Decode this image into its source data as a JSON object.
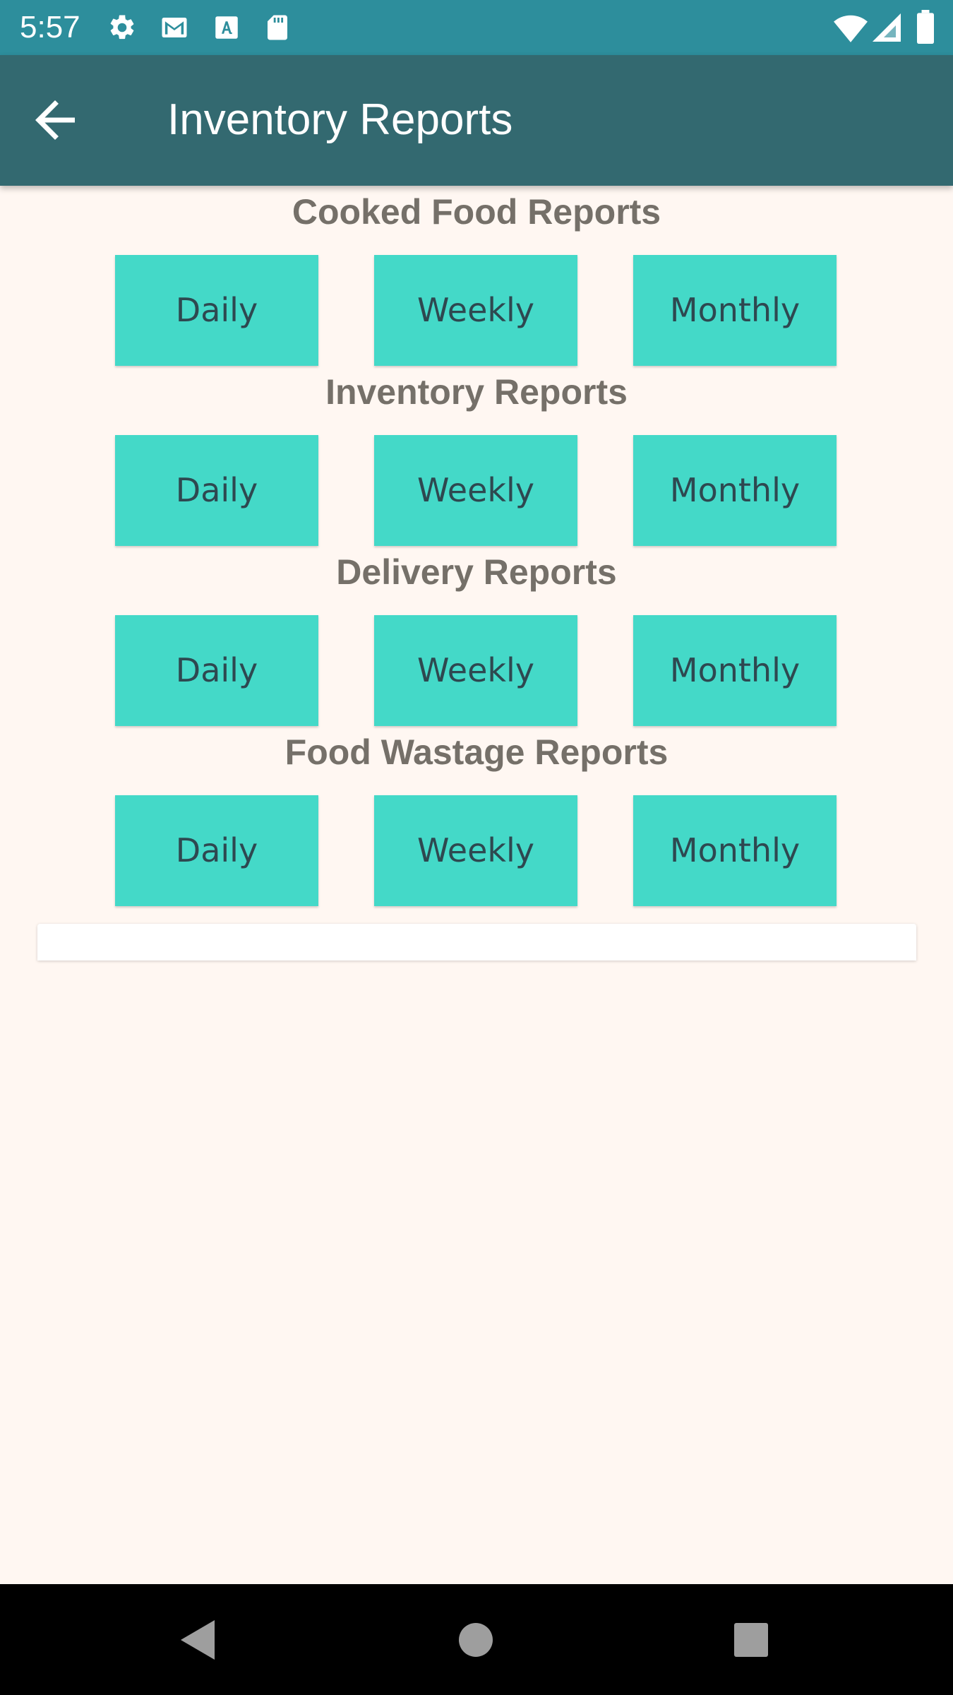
{
  "status_bar": {
    "time": "5:57",
    "left_icons": [
      "settings-icon",
      "gmail-icon",
      "a-notification-icon",
      "sd-card-icon"
    ],
    "right_icons": [
      "wifi-icon",
      "signal-icon",
      "battery-icon"
    ]
  },
  "app_bar": {
    "title": "Inventory Reports",
    "back_icon": "arrow-back-icon"
  },
  "sections": [
    {
      "title": "Cooked Food Reports",
      "buttons": [
        "Daily",
        "Weekly",
        "Monthly"
      ]
    },
    {
      "title": "Inventory Reports",
      "buttons": [
        "Daily",
        "Weekly",
        "Monthly"
      ]
    },
    {
      "title": "Delivery Reports",
      "buttons": [
        "Daily",
        "Weekly",
        "Monthly"
      ]
    },
    {
      "title": "Food Wastage Reports",
      "buttons": [
        "Daily",
        "Weekly",
        "Monthly"
      ]
    }
  ],
  "nav_bar": {
    "icons": [
      "back-triangle-icon",
      "home-circle-icon",
      "recents-square-icon"
    ]
  },
  "colors": {
    "status_bar": "#2D8E9C",
    "app_bar": "#336970",
    "background": "#FFF7F2",
    "button": "#44D9C8",
    "button_text": "#2E4850",
    "section_title": "#757069"
  }
}
